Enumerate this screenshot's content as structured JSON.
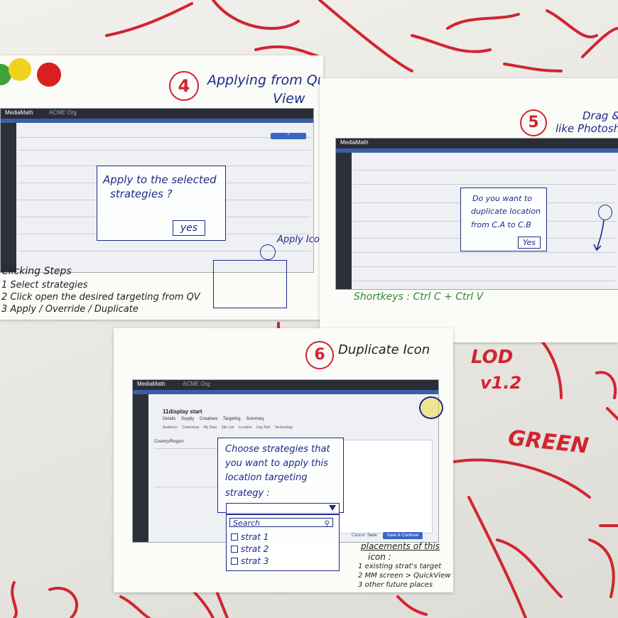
{
  "sheet4": {
    "number": "4",
    "title_line1": "Applying from Quick",
    "title_line2": "View",
    "app_name": "MediaMath",
    "org": "ACME Org",
    "dialog_line1": "Apply to the selected",
    "dialog_line2": "strategies ?",
    "yes": "yes",
    "apply_icon": "Apply Icon",
    "steps_title": "Clicking Steps",
    "steps": [
      "1  Select strategies",
      "2  Click open the desired targeting from QV",
      "3  Apply / Override / Duplicate"
    ]
  },
  "sheet5": {
    "number": "5",
    "title_line1": "Drag &",
    "title_line2": "like Photoshop",
    "app_name": "MediaMath",
    "dialog_line1": "Do you want to",
    "dialog_line2": "duplicate location",
    "dialog_line3": "from C.A to C.B",
    "yes": "Yes",
    "shortkeys": "Shortkeys :  Ctrl C + Ctrl V"
  },
  "sheet6": {
    "number": "6",
    "title": "Duplicate Icon",
    "app_name": "MediaMath",
    "org": "ACME Org",
    "strategy_name": "11display start",
    "tabs": [
      "Details",
      "Supply",
      "Creatives",
      "Targeting",
      "Summary"
    ],
    "subtabs": [
      "Audience",
      "Contextual",
      "My Data",
      "Site List",
      "Location",
      "Day Part",
      "Technology"
    ],
    "panel_header": "Country/Region",
    "dialog_line1": "Choose strategies that",
    "dialog_line2": "you want to apply this",
    "dialog_line3": "location targeting",
    "dialog_line4": "strategy :",
    "search": "Search",
    "strats": [
      "strat 1",
      "strat 2",
      "strat 3"
    ],
    "cancel": "Cancel",
    "save": "Save",
    "save_continue": "Save & Continue",
    "placements_title": "placements of this",
    "placements_sub": "icon :",
    "placements": [
      "1  existing strat's target",
      "2  MM screen > QuickView",
      "3  other future places"
    ]
  },
  "wall": {
    "text1": "LOD",
    "text2": "v1.2",
    "text3": "GREEN"
  },
  "colors": {
    "marker_red": "#d22430",
    "marker_blue": "#1d2a8a",
    "marker_green": "#2f8a3a",
    "dot_green": "#3aa33a",
    "dot_yellow": "#f1d21c",
    "dot_red": "#d8201e"
  }
}
